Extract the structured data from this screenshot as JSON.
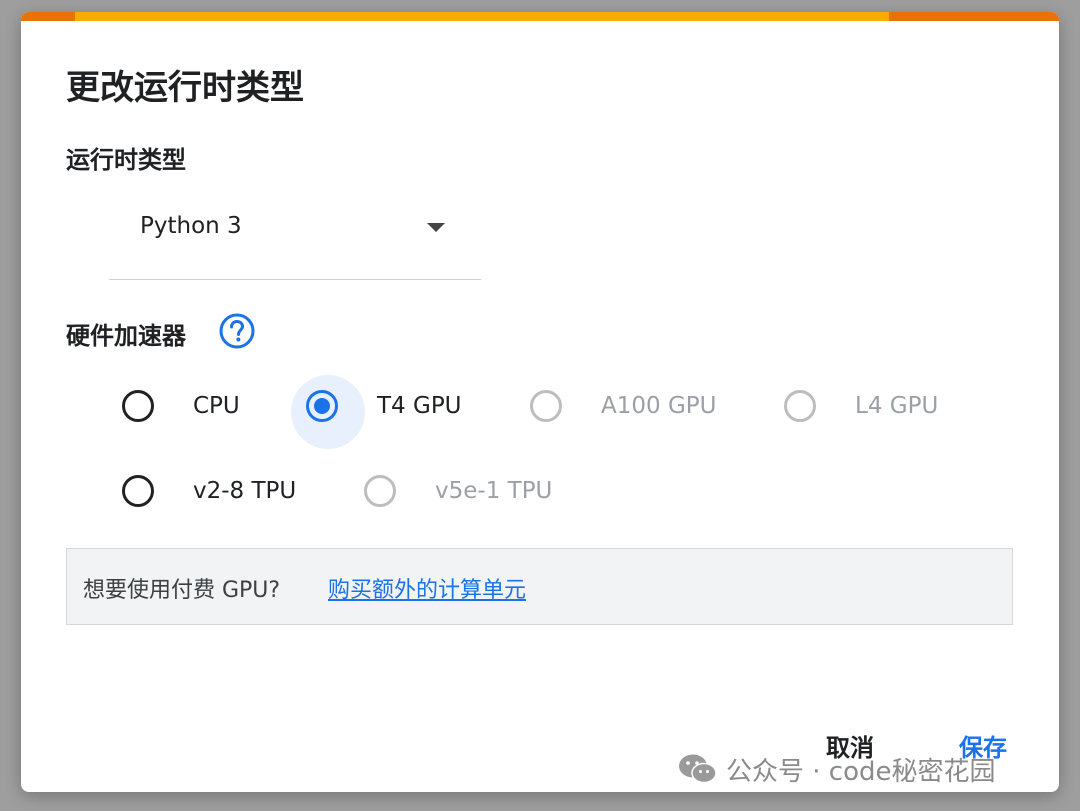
{
  "dialog": {
    "title": "更改运行时类型",
    "runtime_label": "运行时类型",
    "runtime_value": "Python 3",
    "accelerator_label": "硬件加速器",
    "accelerators": [
      {
        "label": "CPU",
        "checked": false,
        "disabled": false
      },
      {
        "label": "T4 GPU",
        "checked": true,
        "disabled": false
      },
      {
        "label": "A100 GPU",
        "checked": false,
        "disabled": true
      },
      {
        "label": "L4 GPU",
        "checked": false,
        "disabled": true
      },
      {
        "label": "v2-8 TPU",
        "checked": false,
        "disabled": false
      },
      {
        "label": "v5e-1 TPU",
        "checked": false,
        "disabled": true
      }
    ],
    "notice_text": "想要使用付费 GPU?",
    "notice_link": "购买额外的计算单元",
    "cancel_label": "取消",
    "save_label": "保存"
  },
  "watermark": {
    "text": "公众号 · code秘密花园"
  },
  "colors": {
    "accent": "#1a73e8",
    "top_bar_orange": "#e8710a",
    "top_bar_yellow": "#f9ab00",
    "disabled": "#bdbdbd"
  }
}
